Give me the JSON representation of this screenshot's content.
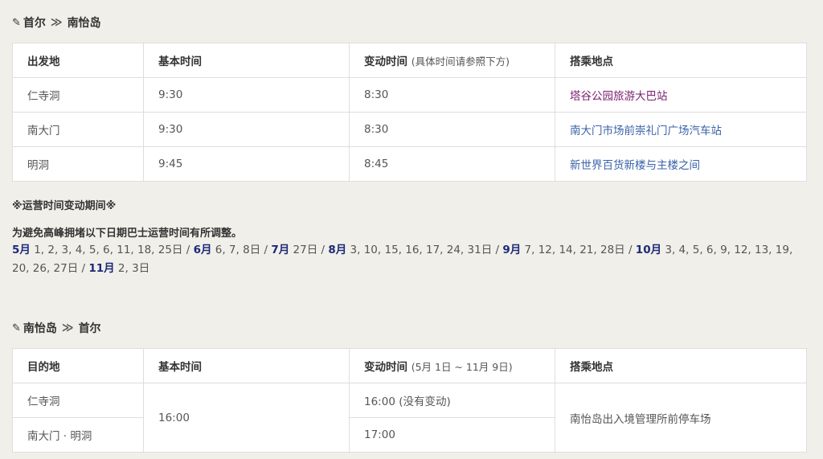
{
  "section1": {
    "from": "首尔",
    "to": "南怡岛",
    "sep": "≫",
    "headers": {
      "col1": "出发地",
      "col2": "基本时间",
      "col3": "变动时间",
      "col3_note": "(具体时间请参照下方)",
      "col4": "搭乘地点"
    },
    "rows": [
      {
        "place": "仁寺洞",
        "basic": "9:30",
        "changed": "8:30",
        "pickup": "塔谷公园旅游大巴站"
      },
      {
        "place": "南大门",
        "basic": "9:30",
        "changed": "8:30",
        "pickup": "南大门市场前崇礼门广场汽车站"
      },
      {
        "place": "明洞",
        "basic": "9:45",
        "changed": "8:45",
        "pickup": "新世界百货新楼与主楼之间"
      }
    ]
  },
  "notice": {
    "title": "※运营时间变动期间※",
    "line": "为避免高峰拥堵以下日期巴士运营时间有所调整。",
    "months": [
      {
        "month": "5月",
        "days": " 1, 2, 3, 4, 5, 6, 11, 18, 25日 / "
      },
      {
        "month": "6月",
        "days": " 6, 7, 8日 / "
      },
      {
        "month": "7月",
        "days": " 27日 / "
      },
      {
        "month": "8月",
        "days": " 3, 10, 15, 16, 17, 24, 31日 / "
      },
      {
        "month": "9月",
        "days": " 7, 12, 14, 21, 28日 / "
      },
      {
        "month": "10月",
        "days": " 3, 4, 5, 6, 9, 12, 13, 19, 20, 26, 27日  / "
      },
      {
        "month": "11月",
        "days": " 2, 3日"
      }
    ]
  },
  "section2": {
    "from": "南怡岛",
    "to": "首尔",
    "sep": "≫",
    "headers": {
      "col1": "目的地",
      "col2": "基本时间",
      "col3": "变动时间",
      "col3_note": "(5月 1日 ~ 11月 9日)",
      "col4": "搭乘地点"
    },
    "rows": [
      {
        "place": "仁寺洞",
        "changed": "16:00 (没有变动)"
      },
      {
        "place": "南大门 · 明洞",
        "changed": "17:00"
      }
    ],
    "basic": "16:00",
    "pickup": "南怡岛出入境管理所前停车场"
  }
}
